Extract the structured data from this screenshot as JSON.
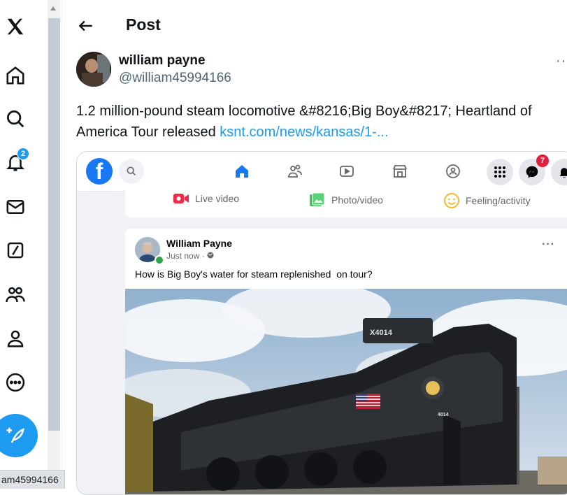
{
  "nav": {
    "notifications_badge": "2",
    "items": [
      "x-logo",
      "home",
      "explore",
      "notifications",
      "messages",
      "grok",
      "communities",
      "profile",
      "more"
    ]
  },
  "status_bar_url": "am45994166",
  "header": {
    "title": "Post"
  },
  "post": {
    "author_name": "william payne",
    "author_handle": "@william45994166",
    "text": "1.2 million-pound steam locomotive &#8216;Big Boy&#8217; Heartland of America Tour released ",
    "link_text": "ksnt.com/news/kansas/1-..."
  },
  "embedded": {
    "messenger_badge": "7",
    "composer_actions": [
      "Live video",
      "Photo/video",
      "Feeling/activity"
    ],
    "fb_post": {
      "author": "William Payne",
      "meta": "Just now · ",
      "text": "How is Big Boy's water for steam replenished  on tour?",
      "photo_lettering": [
        "X4014",
        "4014"
      ]
    }
  },
  "colors": {
    "accent": "#1d9bf0",
    "facebook_blue": "#1877f2",
    "text": "#0f1419",
    "muted": "#536471"
  }
}
